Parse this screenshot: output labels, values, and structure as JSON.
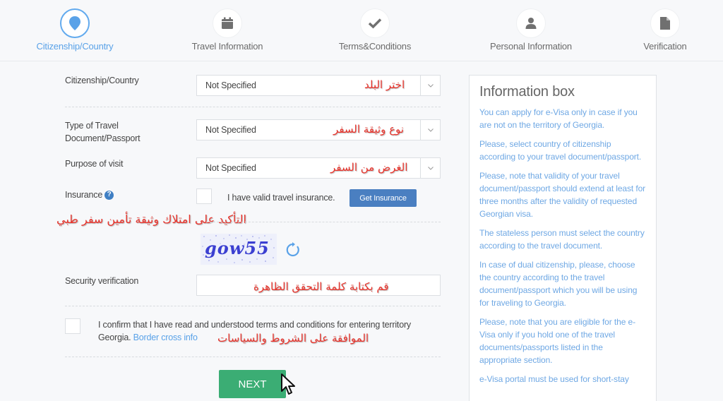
{
  "stepper": {
    "steps": [
      {
        "label": "Citizenship/Country",
        "icon": "map-pin-icon",
        "active": true
      },
      {
        "label": "Travel Information",
        "icon": "calendar-icon",
        "active": false
      },
      {
        "label": "Terms&Conditions",
        "icon": "checkmark-icon",
        "active": false
      },
      {
        "label": "Personal Information",
        "icon": "user-icon",
        "active": false
      },
      {
        "label": "Verification",
        "icon": "document-icon",
        "active": false
      }
    ]
  },
  "form": {
    "citizenship": {
      "label": "Citizenship/Country",
      "value": "Not Specified",
      "annotation": "اختر البلد"
    },
    "document": {
      "label_line1": "Type of Travel",
      "label_line2": "Document/Passport",
      "value": "Not Specified",
      "annotation": "نوع وثيقة السفر"
    },
    "purpose": {
      "label": "Purpose of visit",
      "value": "Not Specified",
      "annotation": "الغرض من السفر"
    },
    "insurance": {
      "label": "Insurance",
      "checkbox_label": "I have valid travel insurance.",
      "button": "Get Insurance",
      "annotation": "التأكيد على امتلاك وثيقة تأمين سفر طبي"
    },
    "captcha": {
      "text": "gow55"
    },
    "security": {
      "label": "Security verification",
      "value": "",
      "annotation": "قم بكتابة كلمة التحقق الظاهرة"
    },
    "confirm": {
      "text": "I confirm that I have read and understood terms and conditions for entering territory Georgia.",
      "link": "Border cross info",
      "annotation": "الموافقة على الشروط والسياسات"
    },
    "next_button": "NEXT"
  },
  "info_box": {
    "title": "Information box",
    "paragraphs": [
      "You can apply for e-Visa only in case if you are not on the territory of Georgia.",
      "Please, select country of citizenship according to your travel document/passport.",
      "Please, note that validity of your travel document/passport should extend at least for three months after the validity of requested Georgian visa.",
      "The stateless person must select the country according to the travel document.",
      "In case of dual citizenship, please, choose the country according to the travel document/passport which you will be using for traveling to Georgia.",
      "Please, note that you are eligible for the e-Visa only if you hold one of the travel documents/passports listed in the appropriate section.",
      "e-Visa portal must be used for short-stay"
    ]
  },
  "colors": {
    "accent_blue": "#5aa2e8",
    "insurance_button": "#4a7fc1",
    "next_button": "#3bad74",
    "annotation_red": "#e8342c"
  }
}
